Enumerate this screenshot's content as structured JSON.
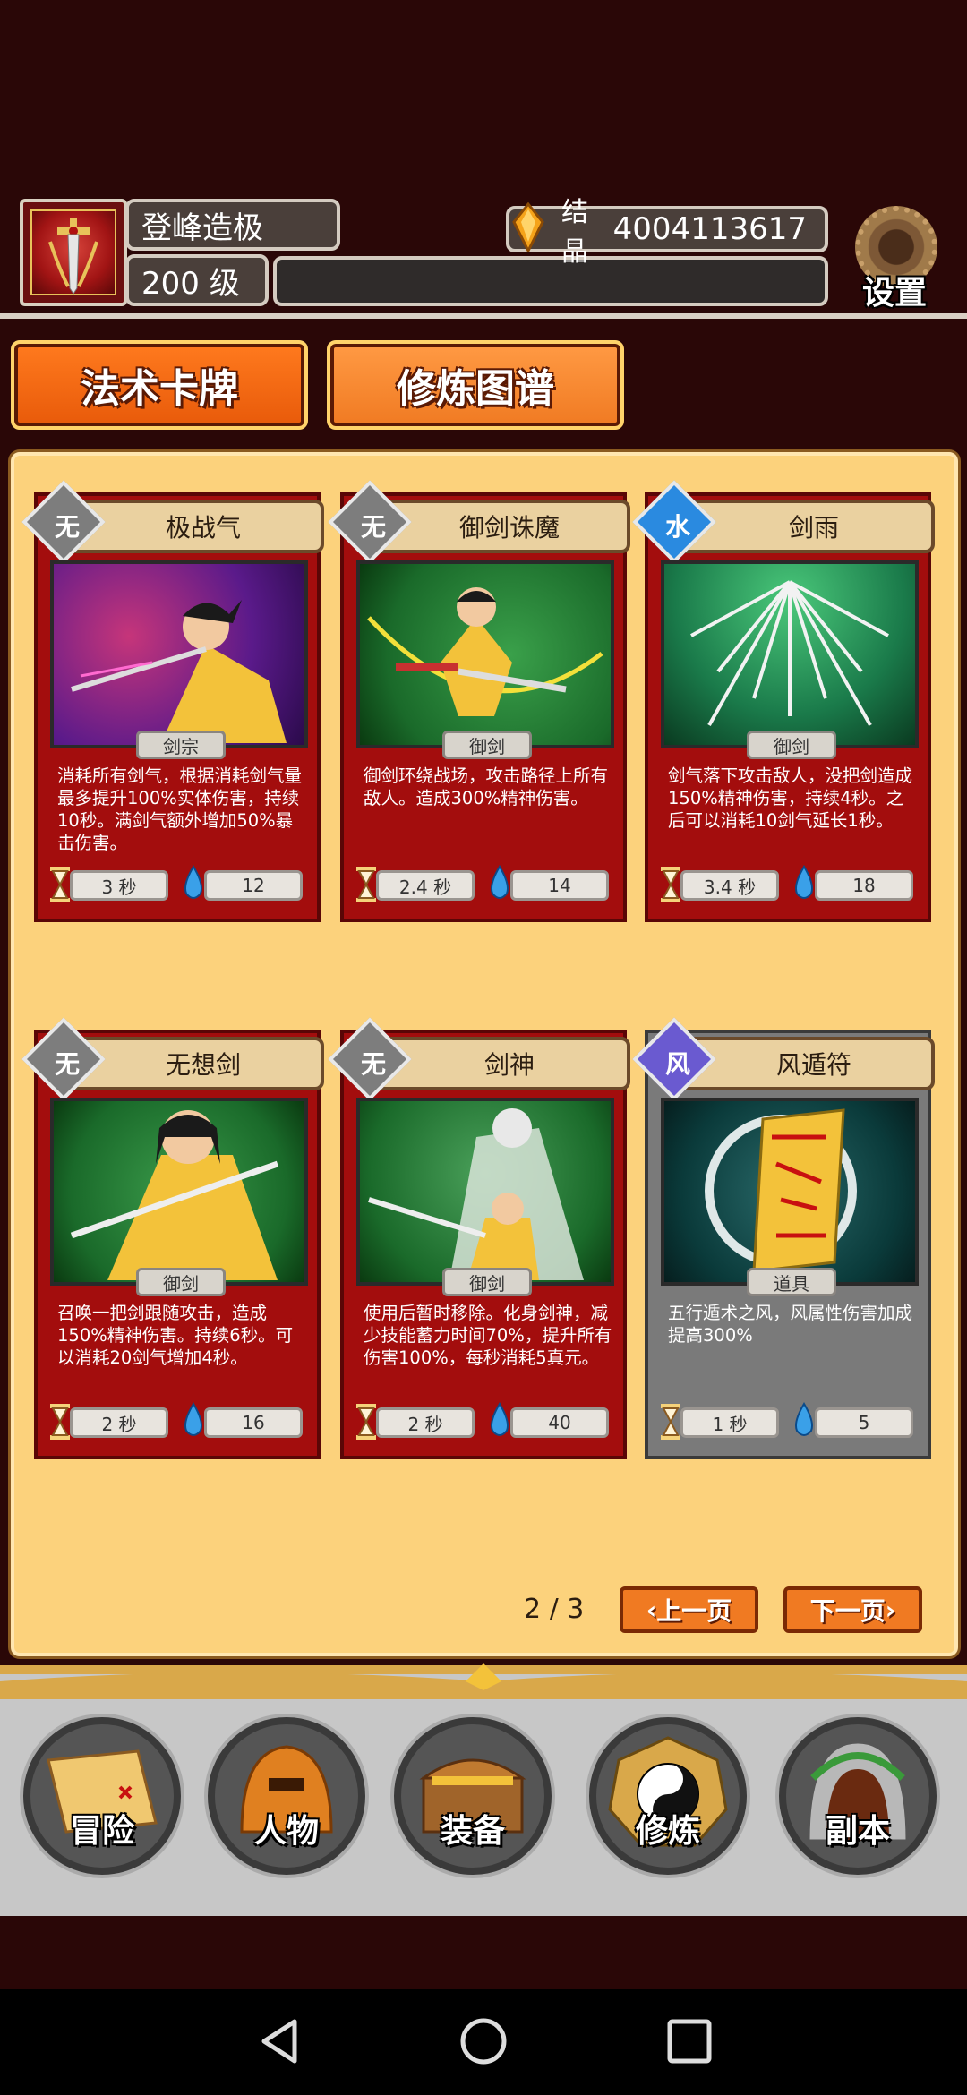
{
  "header": {
    "player_name": "登峰造极",
    "level": "200 级",
    "crystal_label": "结晶",
    "crystal_value": "4004113617",
    "settings_label": "设置"
  },
  "tabs": [
    {
      "label": "法术卡牌",
      "active": true
    },
    {
      "label": "修炼图谱",
      "active": false
    }
  ],
  "cards": [
    {
      "element": "无",
      "title": "极战气",
      "category": "剑宗",
      "desc": "消耗所有剑气，根据消耗剑气量最多提升100%实体伤害，持续10秒。满剑气额外增加50%暴击伤害。",
      "cooldown": "3 秒",
      "cost": "12"
    },
    {
      "element": "无",
      "title": "御剑诛魔",
      "category": "御剑",
      "desc": "御剑环绕战场，攻击路径上所有敌人。造成300%精神伤害。",
      "cooldown": "2.4 秒",
      "cost": "14"
    },
    {
      "element": "水",
      "title": "剑雨",
      "category": "御剑",
      "desc": "剑气落下攻击敌人，没把剑造成150%精神伤害，持续4秒。之后可以消耗10剑气延长1秒。",
      "cooldown": "3.4 秒",
      "cost": "18"
    },
    {
      "element": "无",
      "title": "无想剑",
      "category": "御剑",
      "desc": "召唤一把剑跟随攻击，造成150%精神伤害。持续6秒。可以消耗20剑气增加4秒。",
      "cooldown": "2 秒",
      "cost": "16"
    },
    {
      "element": "无",
      "title": "剑神",
      "category": "御剑",
      "desc": "使用后暂时移除。化身剑神，减少技能蓄力时间70%，提升所有伤害100%，每秒消耗5真元。",
      "cooldown": "2 秒",
      "cost": "40"
    },
    {
      "element": "风",
      "title": "风遁符",
      "category": "道具",
      "desc": "五行遁术之风，风属性伤害加成提高300%",
      "cooldown": "1 秒",
      "cost": "5"
    }
  ],
  "pager": {
    "text": "2 / 3",
    "prev_label": "上一页",
    "next_label": "下一页"
  },
  "nav": [
    {
      "label": "冒险",
      "icon": "map-icon"
    },
    {
      "label": "人物",
      "icon": "helmet-icon"
    },
    {
      "label": "装备",
      "icon": "treasure-chest-icon"
    },
    {
      "label": "修炼",
      "icon": "yin-yang-icon"
    },
    {
      "label": "副本",
      "icon": "cave-portal-icon"
    }
  ],
  "colors": {
    "background": "#2a0707",
    "panel": "#fcd27c",
    "card_red": "#a30d0d",
    "tab_orange": "#ff7a1e"
  }
}
